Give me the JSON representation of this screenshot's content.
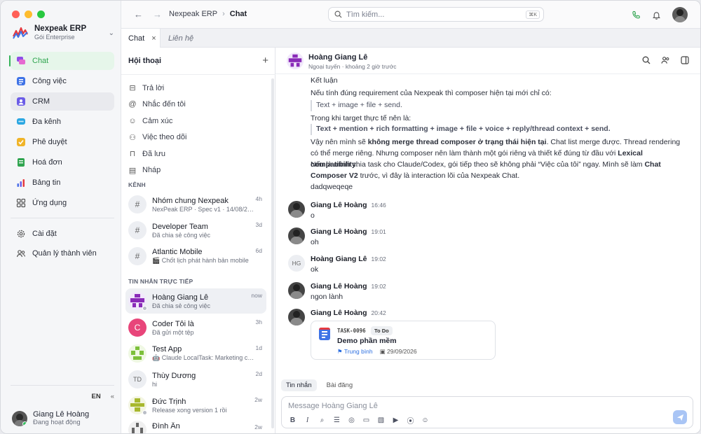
{
  "app": {
    "name": "Nexpeak ERP",
    "plan": "Gói Enterprise"
  },
  "nav": {
    "items": [
      {
        "label": "Chat",
        "icon": "chat-icon",
        "color": "#8e4ee8"
      },
      {
        "label": "Công việc",
        "icon": "tasks-icon",
        "color": "#3f73e6"
      },
      {
        "label": "CRM",
        "icon": "crm-icon",
        "color": "#6b5ce7"
      },
      {
        "label": "Đa kênh",
        "icon": "omnichannel-icon",
        "color": "#2ba7e2"
      },
      {
        "label": "Phê duyệt",
        "icon": "approval-icon",
        "color": "#f0b428"
      },
      {
        "label": "Hoá đơn",
        "icon": "invoice-icon",
        "color": "#2fa44f"
      },
      {
        "label": "Bảng tin",
        "icon": "newsfeed-icon",
        "color": "#4a6ee8"
      },
      {
        "label": "Ứng dụng",
        "icon": "apps-grid-icon",
        "color": "#555555"
      }
    ],
    "bottom": [
      {
        "label": "Cài đặt",
        "icon": "gear-icon"
      },
      {
        "label": "Quản lý thành viên",
        "icon": "members-icon"
      }
    ],
    "lang": "EN",
    "user": {
      "name": "Giang Lê Hoàng",
      "status": "Đang hoạt động"
    }
  },
  "topbar": {
    "breadcrumb_root": "Nexpeak ERP",
    "breadcrumb_current": "Chat",
    "search_placeholder": "Tìm kiếm...",
    "shortcut": "⌘K"
  },
  "tabs": [
    {
      "label": "Chat"
    },
    {
      "label": "Liên hệ"
    }
  ],
  "conversations": {
    "title": "Hội thoại",
    "quick": [
      {
        "label": "Trả lời",
        "icon": "reply-icon"
      },
      {
        "label": "Nhắc đến tôi",
        "icon": "mention-icon"
      },
      {
        "label": "Cảm xúc",
        "icon": "emoji-icon"
      },
      {
        "label": "Việc theo dõi",
        "icon": "follow-icon"
      },
      {
        "label": "Đã lưu",
        "icon": "bookmark-icon"
      },
      {
        "label": "Nháp",
        "icon": "draft-icon"
      }
    ],
    "channels_label": "KÊNH",
    "channels": [
      {
        "name": "Nhóm chung Nexpeak",
        "sub": "NexPeak ERP · Spec v1 · 14/08/2026B...",
        "time": "4h"
      },
      {
        "name": "Developer Team",
        "sub": "Đã chia sẻ công việc",
        "time": "3d"
      },
      {
        "name": "Atlantic Mobile",
        "sub": "🎬 Chốt lịch phát hành bản mobile",
        "time": "6d"
      }
    ],
    "dm_label": "TIN NHẮN TRỰC TIẾP",
    "dms": [
      {
        "name": "Hoàng Giang Lê",
        "sub": "Đã chia sẻ công việc",
        "time": "now",
        "avatar": "identicon-purple"
      },
      {
        "name": "Coder Tôi là",
        "sub": "Đã gửi một tệp",
        "time": "3h",
        "avatar": "C",
        "color": "#e8457a"
      },
      {
        "name": "Test App",
        "sub": "🤖 Claude LocalTask: Marketing cho N...",
        "time": "1d",
        "avatar": "identicon-green"
      },
      {
        "name": "Thùy Dương",
        "sub": "hi",
        "time": "2d",
        "avatar": "TD"
      },
      {
        "name": "Đức Trịnh",
        "sub": "Release xong version 1 rồi",
        "time": "2w",
        "avatar": "identicon-olive"
      },
      {
        "name": "Đình Ân",
        "sub": "",
        "time": "2w",
        "avatar": "identicon-gray"
      }
    ]
  },
  "chat": {
    "contact": "Hoàng Giang Lê",
    "status": "Ngoại tuyến · khoảng 2 giờ trước",
    "long_message": {
      "conclusion": "Kết luận",
      "line1": "Nếu tính đúng requirement của Nexpeak thì composer hiện tại mới chỉ có:",
      "quote1": "Text + image + file + send.",
      "line2": "Trong khi target thực tế nên là:",
      "quote2": "Text + mention + rich formatting + image + file + voice + reply/thread context + send.",
      "p3_a": "Vậy nên mình sẽ ",
      "p3_b": "không merge thread composer ở trạng thái hiện tại",
      "p3_c": ". Chat list merge được. Thread rendering có thể merge riêng. Nhưng composer nên làm thành một gói riêng và thiết kế đúng từ đầu với ",
      "p3_d": "Lexical compatibility",
      "p3_e": ".",
      "p4_a": "Nếu là mình chia task cho Claude/Codex, gói tiếp theo sẽ không phải “Việc của tôi” ngay. Mình sẽ làm ",
      "p4_b": "Chat Composer V2",
      "p4_c": " trước, vì đây là interaction lõi của Nexpeak Chat.",
      "tail": "dadqweqeqe"
    },
    "messages": [
      {
        "who": "Giang Lê Hoàng",
        "time": "16:46",
        "text": "o"
      },
      {
        "who": "Giang Lê Hoàng",
        "time": "19:01",
        "text": "oh"
      },
      {
        "who": "Hoàng Giang Lê",
        "time": "19:02",
        "text": "ok",
        "initials": "HG"
      },
      {
        "who": "Giang Lê Hoàng",
        "time": "19:02",
        "text": "ngon lành"
      },
      {
        "who": "Giang Lê Hoàng",
        "time": "20:42",
        "text": ""
      }
    ],
    "task": {
      "id": "TASK-0096",
      "status": "To Do",
      "title": "Demo phần mềm",
      "priority": "Trung bình",
      "date": "29/09/2026"
    },
    "composer_tabs": [
      "Tin nhắn",
      "Bài đăng"
    ],
    "composer_placeholder": "Message Hoàng Giang Lê"
  }
}
